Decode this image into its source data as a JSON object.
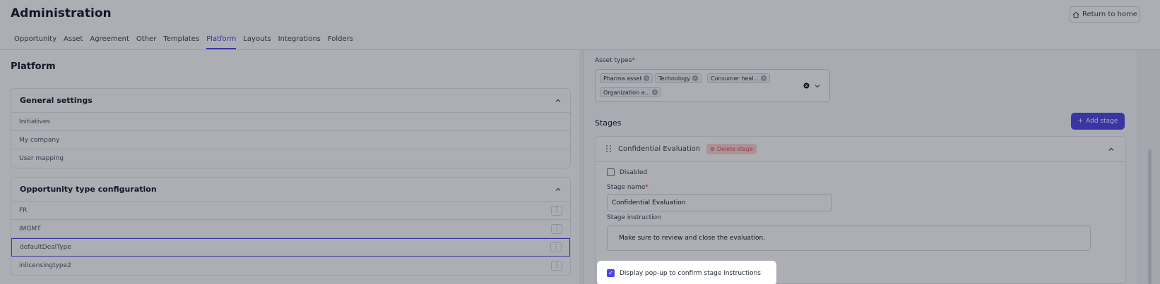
{
  "header": {
    "title": "Administration",
    "return_label": "Return to home"
  },
  "tabs": [
    {
      "label": "Opportunity"
    },
    {
      "label": "Asset"
    },
    {
      "label": "Agreement"
    },
    {
      "label": "Other"
    },
    {
      "label": "Templates"
    },
    {
      "label": "Platform",
      "active": true
    },
    {
      "label": "Layouts"
    },
    {
      "label": "Integrations"
    },
    {
      "label": "Folders"
    }
  ],
  "left": {
    "title": "Platform",
    "general": {
      "title": "General settings",
      "items": [
        "Initiatives",
        "My company",
        "User mapping"
      ]
    },
    "opportunity": {
      "title": "Opportunity type configuration",
      "items": [
        "FR",
        "IMGMT",
        "defaultDealType",
        "inlicensingtype2"
      ]
    }
  },
  "right": {
    "asset_types": {
      "label": "Asset types",
      "required": "*",
      "chips": [
        "Pharma asset",
        "Technology",
        "Consumer heal...",
        "Organization a..."
      ]
    },
    "stages_title": "Stages",
    "add_stage_label": "Add stage",
    "stage": {
      "name": "Confidential Evaluation",
      "delete_label": "Delete stage",
      "disabled_label": "Disabled",
      "name_label": "Stage name",
      "name_required": "*",
      "name_value": "Confidential Evaluation",
      "instruction_label": "Stage instruction",
      "instruction_value": "Make sure to review and close the evaluation.",
      "popup_label": "Display pop-up to confirm stage instructions",
      "popup_checked": true,
      "disabled_checked": false
    }
  },
  "colors": {
    "accent": "#4f46e5",
    "danger": "#dc2626"
  }
}
